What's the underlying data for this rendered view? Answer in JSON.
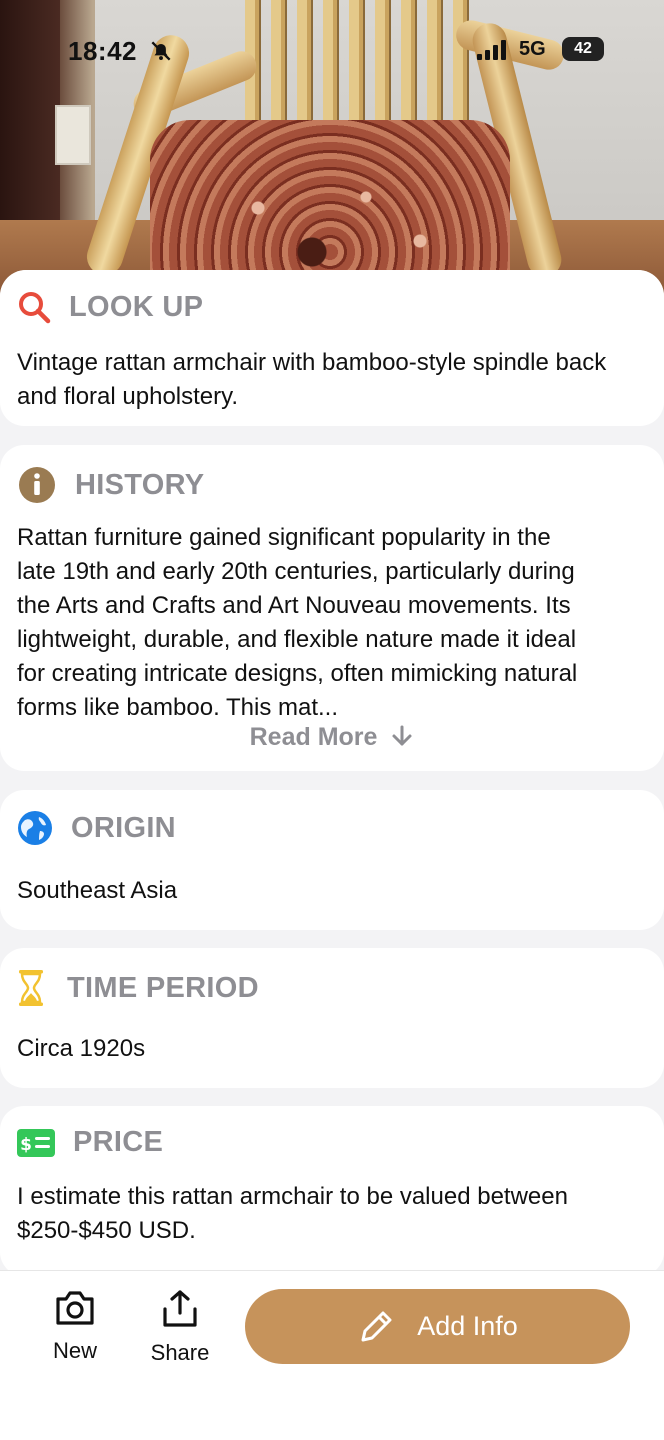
{
  "status_bar": {
    "time": "18:42",
    "network": "5G",
    "battery": "42"
  },
  "sections": {
    "lookup": {
      "title": "LOOK UP",
      "body": "Vintage rattan armchair with bamboo-style spindle back and floral upholstery."
    },
    "history": {
      "title": "HISTORY",
      "lines": [
        "Rattan furniture gained significant popularity in the",
        "late 19th and early 20th centuries, particularly during",
        "the Arts and Crafts and Art Nouveau movements. Its",
        "lightweight, durable, and flexible nature made it ideal",
        "for creating intricate designs, often mimicking natural",
        "forms like bamboo. This mat..."
      ],
      "read_more": "Read More"
    },
    "origin": {
      "title": "ORIGIN",
      "body": "Southeast Asia"
    },
    "time_period": {
      "title": "TIME PERIOD",
      "body": "Circa 1920s"
    },
    "price": {
      "title": "PRICE",
      "body": "I estimate this rattan armchair to be valued between $250-$450 USD."
    }
  },
  "toolbar": {
    "new_label": "New",
    "share_label": "Share",
    "add_info_label": "Add Info"
  },
  "colors": {
    "accent": "#c6935b",
    "muted": "#8e8e93",
    "lookup_icon": "#e74c3c",
    "history_icon": "#9a7b52",
    "origin_icon": "#1a7fe6",
    "time_icon": "#f2c230",
    "price_icon": "#34c759"
  },
  "icons": [
    "magnifier-icon",
    "info-icon",
    "globe-icon",
    "hourglass-icon",
    "money-icon",
    "camera-icon",
    "share-icon",
    "pencil-icon",
    "bell-slash-icon",
    "signal-icon",
    "battery-icon"
  ]
}
